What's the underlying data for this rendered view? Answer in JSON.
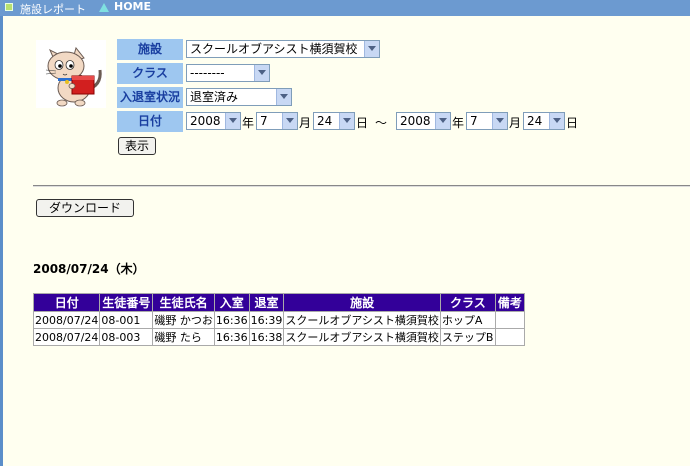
{
  "topbar": {
    "title": "施設レポート",
    "home": "HOME"
  },
  "form": {
    "facility_label": "施設",
    "facility_value": "スクールオブアシスト横須賀校",
    "class_label": "クラス",
    "class_value": "--------",
    "status_label": "入退室状況",
    "status_value": "退室済み",
    "date_label": "日付",
    "from": {
      "year": "2008",
      "month": "7",
      "day": "24"
    },
    "to": {
      "year": "2008",
      "month": "7",
      "day": "24"
    },
    "year_unit": "年",
    "month_unit": "月",
    "day_unit": "日",
    "tilde": "〜",
    "show_button": "表示"
  },
  "download_button": "ダウンロード",
  "date_heading": "2008/07/24（木）",
  "table": {
    "headers": [
      "日付",
      "生徒番号",
      "生徒氏名",
      "入室",
      "退室",
      "施設",
      "クラス",
      "備考"
    ],
    "rows": [
      [
        "2008/07/24",
        "08-001",
        "磯野 かつお",
        "16:36",
        "16:39",
        "スクールオブアシスト横須賀校",
        "ホップA",
        ""
      ],
      [
        "2008/07/24",
        "08-003",
        "磯野 たら",
        "16:36",
        "16:38",
        "スクールオブアシスト横須賀校",
        "ステップB",
        ""
      ]
    ]
  },
  "colors": {
    "topbar": "#6c9ad0",
    "label_bg": "#9ec7f0",
    "table_header": "#330099",
    "page_bg": "#fffff0"
  }
}
